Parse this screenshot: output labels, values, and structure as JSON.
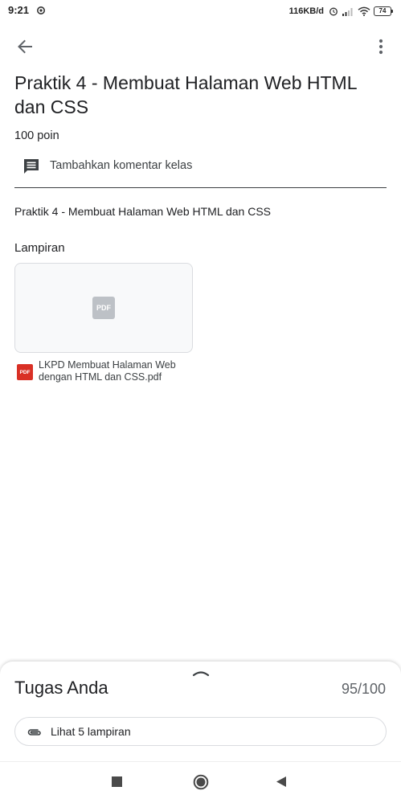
{
  "status_bar": {
    "time": "9:21",
    "net_speed": "116KB/d",
    "battery_level": "74",
    "icons": [
      "notification-icon",
      "alarm-icon",
      "signal-icon",
      "wifi-icon",
      "battery-icon"
    ]
  },
  "app_bar": {
    "back_icon": "arrow-left-icon",
    "menu_icon": "more-vert-icon"
  },
  "assignment": {
    "title": "Praktik 4 - Membuat Halaman Web HTML dan CSS",
    "points": "100 poin",
    "comment_label": "Tambahkan komentar kelas",
    "description": "Praktik 4 - Membuat Halaman Web HTML dan CSS"
  },
  "attachments": {
    "section_label": "Lampiran",
    "thumb_label": "PDF",
    "file_icon_label": "PDF",
    "file_name": "LKPD Membuat Halaman Web dengan HTML dan CSS.pdf"
  },
  "bottom_sheet": {
    "title": "Tugas Anda",
    "score": "95/100",
    "view_attachments_label": "Lihat 5 lampiran"
  },
  "colors": {
    "text_primary": "#202124",
    "text_secondary": "#5f6368",
    "divider": "#3c4043",
    "pdf_red": "#d93025",
    "thumb_bg": "#f8f9fa",
    "border": "#dadce0"
  }
}
